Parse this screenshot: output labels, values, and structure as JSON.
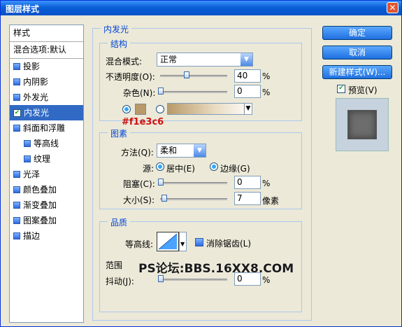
{
  "window": {
    "title": "图层样式"
  },
  "sidebar": {
    "header": "样式",
    "blend": "混合选项:默认",
    "items": [
      "投影",
      "内阴影",
      "外发光",
      "内发光",
      "斜面和浮雕",
      "等高线",
      "纹理",
      "光泽",
      "颜色叠加",
      "渐变叠加",
      "图案叠加",
      "描边"
    ],
    "active": "内发光"
  },
  "panel": {
    "section_title": "内发光",
    "structure": {
      "title": "结构",
      "blend_label": "混合模式:",
      "blend_value": "正常",
      "opacity_label": "不透明度(O):",
      "opacity_value": "40",
      "opacity_unit": "%",
      "noise_label": "杂色(N):",
      "noise_value": "0",
      "noise_unit": "%",
      "color_hex": "#f1e3c6"
    },
    "elements": {
      "title": "图素",
      "method_label": "方法(Q):",
      "method_value": "柔和",
      "source_label": "源:",
      "center_label": "居中(E)",
      "edge_label": "边缘(G)",
      "choke_label": "阻塞(C):",
      "choke_value": "0",
      "choke_unit": "%",
      "size_label": "大小(S):",
      "size_value": "7",
      "size_unit": "像素"
    },
    "quality": {
      "title": "品质",
      "contour_label": "等高线:",
      "antialias_label": "消除锯齿(L)",
      "range_label": "范围",
      "jitter_label": "抖动(J):",
      "jitter_value": "0",
      "jitter_unit": "%"
    }
  },
  "buttons": {
    "ok": "确定",
    "cancel": "取消",
    "new_style": "新建样式(W)...",
    "preview": "预览(V)"
  },
  "watermark": "PS论坛:BBS.16XX8.COM"
}
